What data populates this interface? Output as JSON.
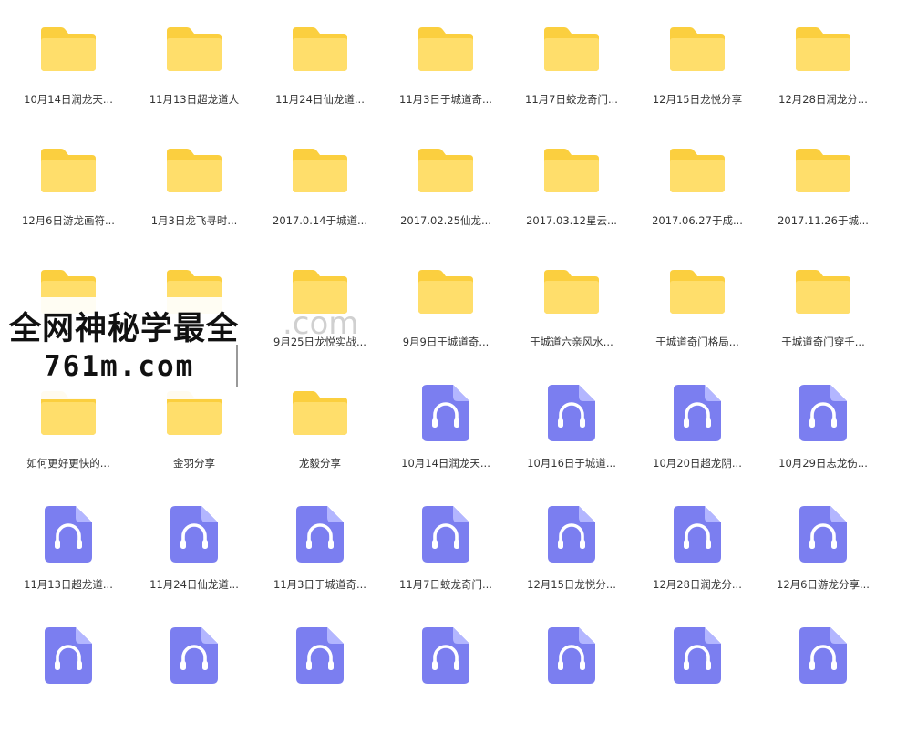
{
  "colors": {
    "folder_back": "#FBCF3F",
    "folder_front": "#FFDE6B",
    "audio_body": "#7B7EF0",
    "audio_fold": "#B3B6FF",
    "label_text": "#333333"
  },
  "icons": {
    "folder": "folder-icon",
    "audio": "audio-file-icon"
  },
  "watermark": {
    "line1": "全网神秘学最全",
    "line2": "761m.com",
    "ghost": ".com"
  },
  "files": [
    {
      "type": "folder",
      "label": "10月14日润龙天..."
    },
    {
      "type": "folder",
      "label": "11月13日超龙道人"
    },
    {
      "type": "folder",
      "label": "11月24日仙龙道..."
    },
    {
      "type": "folder",
      "label": "11月3日于城道奇..."
    },
    {
      "type": "folder",
      "label": "11月7日蛟龙奇门..."
    },
    {
      "type": "folder",
      "label": "12月15日龙悦分享"
    },
    {
      "type": "folder",
      "label": "12月28日润龙分..."
    },
    {
      "type": "folder",
      "label": "12月6日游龙画符..."
    },
    {
      "type": "folder",
      "label": "1月3日龙飞寻时..."
    },
    {
      "type": "folder",
      "label": "2017.0.14于城道..."
    },
    {
      "type": "folder",
      "label": "2017.02.25仙龙..."
    },
    {
      "type": "folder",
      "label": "2017.03.12星云..."
    },
    {
      "type": "folder",
      "label": "2017.06.27于成..."
    },
    {
      "type": "folder",
      "label": "2017.11.26于城..."
    },
    {
      "type": "folder",
      "label": ""
    },
    {
      "type": "folder",
      "label": ""
    },
    {
      "type": "folder",
      "label": "9月25日龙悦实战..."
    },
    {
      "type": "folder",
      "label": "9月9日于城道奇..."
    },
    {
      "type": "folder",
      "label": "于城道六亲风水..."
    },
    {
      "type": "folder",
      "label": "于城道奇门格局..."
    },
    {
      "type": "folder",
      "label": "于城道奇门穿壬..."
    },
    {
      "type": "folder",
      "label": "如何更好更快的..."
    },
    {
      "type": "folder",
      "label": "金羽分享"
    },
    {
      "type": "folder",
      "label": "龙毅分享"
    },
    {
      "type": "audio",
      "label": "10月14日润龙天..."
    },
    {
      "type": "audio",
      "label": "10月16日于城道..."
    },
    {
      "type": "audio",
      "label": "10月20日超龙阴..."
    },
    {
      "type": "audio",
      "label": "10月29日志龙伤..."
    },
    {
      "type": "audio",
      "label": "11月13日超龙道..."
    },
    {
      "type": "audio",
      "label": "11月24日仙龙道..."
    },
    {
      "type": "audio",
      "label": "11月3日于城道奇..."
    },
    {
      "type": "audio",
      "label": "11月7日蛟龙奇门..."
    },
    {
      "type": "audio",
      "label": "12月15日龙悦分..."
    },
    {
      "type": "audio",
      "label": "12月28日润龙分..."
    },
    {
      "type": "audio",
      "label": "12月6日游龙分享..."
    },
    {
      "type": "audio",
      "label": ""
    },
    {
      "type": "audio",
      "label": ""
    },
    {
      "type": "audio",
      "label": ""
    },
    {
      "type": "audio",
      "label": ""
    },
    {
      "type": "audio",
      "label": ""
    },
    {
      "type": "audio",
      "label": ""
    },
    {
      "type": "audio",
      "label": ""
    }
  ]
}
